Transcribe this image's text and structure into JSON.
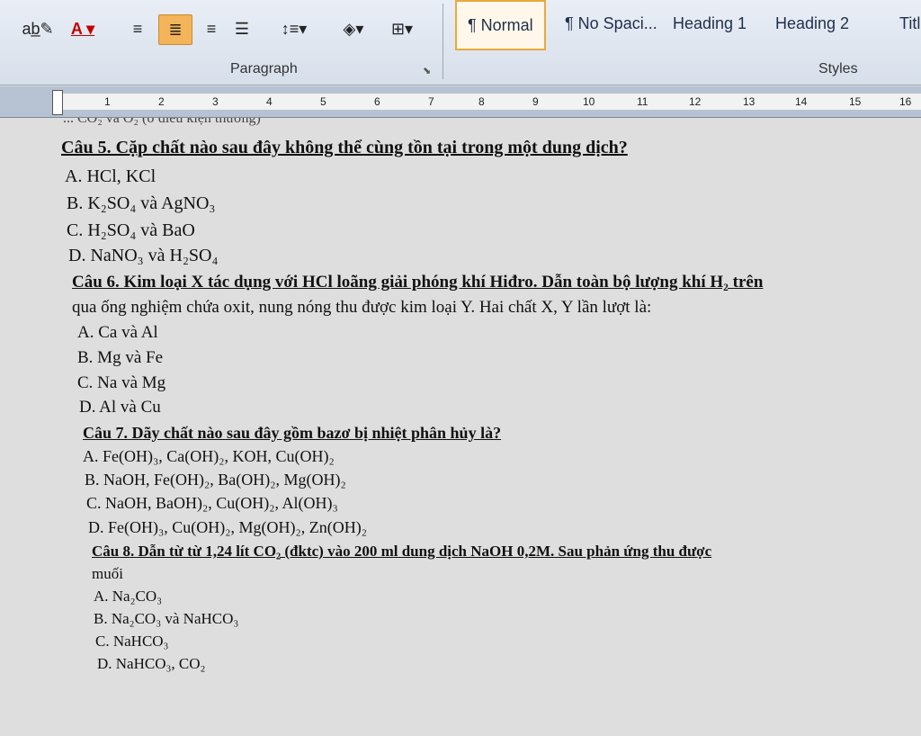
{
  "ribbon": {
    "paragraph_label": "Paragraph",
    "styles_label": "Styles",
    "styles": [
      "¶ Normal",
      "¶ No Spaci...",
      "Heading 1",
      "Heading 2",
      "Titl"
    ]
  },
  "ruler": {
    "numbers": [
      "1",
      "2",
      "3",
      "4",
      "5",
      "6",
      "7",
      "8",
      "9",
      "10",
      "11",
      "12",
      "13",
      "14",
      "15",
      "16"
    ]
  },
  "document": {
    "partial_top": "... CO₂ và O₂ (ở điều kiện thường)",
    "lines": [
      "Câu 5. Cặp chất nào sau đây không thể cùng tồn tại trong một dung dịch?",
      "A. HCl, KCl",
      "B. K₂SO₄ và AgNO₃",
      "C. H₂SO₄ và BaO",
      "D. NaNO₃ và H₂SO₄",
      "Câu 6. Kim loại X tác dụng với HCl loãng giải phóng khí Hiđro. Dẫn toàn bộ lượng khí H₂ trên",
      "qua ống nghiệm chứa oxit, nung nóng thu được kim loại Y. Hai chất X, Y lần lượt là:",
      "A. Ca và Al",
      "B. Mg và Fe",
      "C. Na và Mg",
      "D. Al và Cu",
      "Câu 7. Dãy chất nào sau đây gồm bazơ bị nhiệt phân hủy là?",
      "A. Fe(OH)₃, Ca(OH)₂, KOH, Cu(OH)₂",
      "B. NaOH, Fe(OH)₂, Ba(OH)₂, Mg(OH)₂",
      "C. NaOH, BaOH)₂, Cu(OH)₂, Al(OH)₃",
      "D. Fe(OH)₃, Cu(OH)₂, Mg(OH)₂, Zn(OH)₂",
      "Câu 8. Dẫn từ từ 1,24 lít CO₂ (đktc) vào 200 ml dung dịch NaOH 0,2M. Sau phản ứng thu được",
      "muối",
      "A. Na₂CO₃",
      "B. Na₂CO₃ và NaHCO₃",
      "C. NaHCO₃",
      "D. NaHCO₃, CO₂"
    ]
  }
}
